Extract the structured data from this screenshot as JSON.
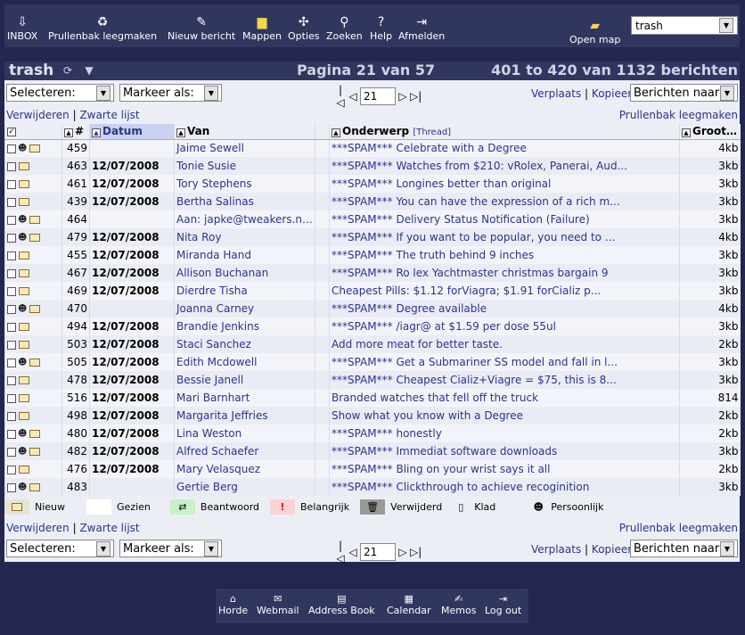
{
  "toolbar": {
    "items": [
      {
        "label": "INBOX",
        "icon": "inbox-icon"
      },
      {
        "label": "Prullenbak leegmaken",
        "icon": "trash-icon"
      },
      {
        "label": "Nieuw bericht",
        "icon": "compose-icon"
      },
      {
        "label": "Mappen",
        "icon": "folders-icon"
      },
      {
        "label": "Opties",
        "icon": "options-icon"
      },
      {
        "label": "Zoeken",
        "icon": "search-icon"
      },
      {
        "label": "Help",
        "icon": "help-icon"
      },
      {
        "label": "Afmelden",
        "icon": "logout-icon"
      },
      {
        "label": "Open map",
        "icon": "open-folder-icon"
      }
    ],
    "folder_select": "trash"
  },
  "header": {
    "folder": "trash",
    "page_info": "Pagina 21 van 57",
    "range_info": "401 to 420 van 1132 berichten"
  },
  "controls": {
    "select_label": "Selecteren:",
    "mark_label": "Markeer als:",
    "page_value": "21",
    "move": "Verplaats",
    "copy": "Kopieer",
    "separator": "|",
    "dest_label": "Berichten naar"
  },
  "links": {
    "delete": "Verwijderen",
    "blacklist": "Zwarte lijst",
    "empty_trash": "Prullenbak leegmaken"
  },
  "columns": {
    "num": "#",
    "date": "Datum",
    "from": "Van",
    "subject": "Onderwerp",
    "thread": "[Thread]",
    "size": "Grootte"
  },
  "messages": [
    {
      "n": "459",
      "date": "",
      "from": "Jaime Sewell",
      "subject": "***SPAM*** Celebrate with a Degree",
      "size": "4kb",
      "personal": true
    },
    {
      "n": "463",
      "date": "12/07/2008",
      "from": "Tonie Susie",
      "subject": "***SPAM*** Watches from $210: vRolex, Panerai, Aud...",
      "size": "3kb",
      "personal": false
    },
    {
      "n": "461",
      "date": "12/07/2008",
      "from": "Tory Stephens",
      "subject": "***SPAM*** Longines better than original",
      "size": "3kb",
      "personal": false
    },
    {
      "n": "439",
      "date": "12/07/2008",
      "from": "Bertha Salinas",
      "subject": "***SPAM*** You can have the expression of a rich m...",
      "size": "3kb",
      "personal": false
    },
    {
      "n": "464",
      "date": "",
      "from": "Aan: japke@tweakers.net",
      "subject": "***SPAM*** Delivery Status Notification (Failure)",
      "size": "3kb",
      "personal": true
    },
    {
      "n": "479",
      "date": "12/07/2008",
      "from": "Nita Roy",
      "subject": "***SPAM*** If you want to be popular, you need to ...",
      "size": "4kb",
      "personal": true
    },
    {
      "n": "455",
      "date": "12/07/2008",
      "from": "Miranda Hand",
      "subject": "***SPAM*** The truth behind 9 inches",
      "size": "3kb",
      "personal": false
    },
    {
      "n": "467",
      "date": "12/07/2008",
      "from": "Allison Buchanan",
      "subject": "***SPAM*** Ro lex Yachtmaster christmas bargain 9",
      "size": "3kb",
      "personal": false
    },
    {
      "n": "469",
      "date": "12/07/2008",
      "from": "Dierdre Tisha",
      "subject": "Cheapest Pills: $1.12 forViagra; $1.91 forCializ p...",
      "size": "3kb",
      "personal": false
    },
    {
      "n": "470",
      "date": "",
      "from": "Joanna Carney",
      "subject": "***SPAM*** Degree available",
      "size": "4kb",
      "personal": true
    },
    {
      "n": "494",
      "date": "12/07/2008",
      "from": "Brandie Jenkins",
      "subject": "***SPAM*** /iagr@ at $1.59 per dose 55ul",
      "size": "3kb",
      "personal": false
    },
    {
      "n": "503",
      "date": "12/07/2008",
      "from": "Staci Sanchez",
      "subject": "Add more meat for better taste.",
      "size": "2kb",
      "personal": false
    },
    {
      "n": "505",
      "date": "12/07/2008",
      "from": "Edith Mcdowell",
      "subject": "***SPAM*** Get a Submariner SS model and fall in l...",
      "size": "3kb",
      "personal": true
    },
    {
      "n": "478",
      "date": "12/07/2008",
      "from": "Bessie Janell",
      "subject": "***SPAM*** Cheapest Cializ+Viagre = $75, this is 8...",
      "size": "3kb",
      "personal": false
    },
    {
      "n": "516",
      "date": "12/07/2008",
      "from": "Mari Barnhart",
      "subject": "Branded watches that fell off the truck",
      "size": "814",
      "personal": false
    },
    {
      "n": "498",
      "date": "12/07/2008",
      "from": "Margarita Jeffries",
      "subject": "Show what you know with a Degree",
      "size": "2kb",
      "personal": false
    },
    {
      "n": "480",
      "date": "12/07/2008",
      "from": "Lina Weston",
      "subject": "***SPAM*** honestly",
      "size": "2kb",
      "personal": true
    },
    {
      "n": "482",
      "date": "12/07/2008",
      "from": "Alfred Schaefer",
      "subject": "***SPAM*** Immediat software downloads",
      "size": "3kb",
      "personal": true
    },
    {
      "n": "476",
      "date": "12/07/2008",
      "from": "Mary Velasquez",
      "subject": "***SPAM*** Bling on your wrist says it all",
      "size": "2kb",
      "personal": false
    },
    {
      "n": "483",
      "date": "",
      "from": "Gertie Berg",
      "subject": "***SPAM*** Clickthrough to achieve recoginition",
      "size": "3kb",
      "personal": true
    }
  ],
  "legend": [
    {
      "label": "Nieuw",
      "icon": "envelope-icon"
    },
    {
      "label": "Gezien",
      "icon": ""
    },
    {
      "label": "Beantwoord",
      "icon": "reply-icon"
    },
    {
      "label": "Belangrijk",
      "icon": "exclamation-icon"
    },
    {
      "label": "Verwijderd",
      "icon": "bin-icon"
    },
    {
      "label": "Klad",
      "icon": "draft-icon"
    },
    {
      "label": "Persoonlijk",
      "icon": "person-icon"
    }
  ],
  "bottom_nav": [
    {
      "label": "Horde",
      "icon": "home-icon"
    },
    {
      "label": "Webmail",
      "icon": "mail-icon"
    },
    {
      "label": "Address Book",
      "icon": "addressbook-icon"
    },
    {
      "label": "Calendar",
      "icon": "calendar-icon"
    },
    {
      "label": "Memos",
      "icon": "memo-icon"
    },
    {
      "label": "Log out",
      "icon": "logout-icon"
    }
  ]
}
